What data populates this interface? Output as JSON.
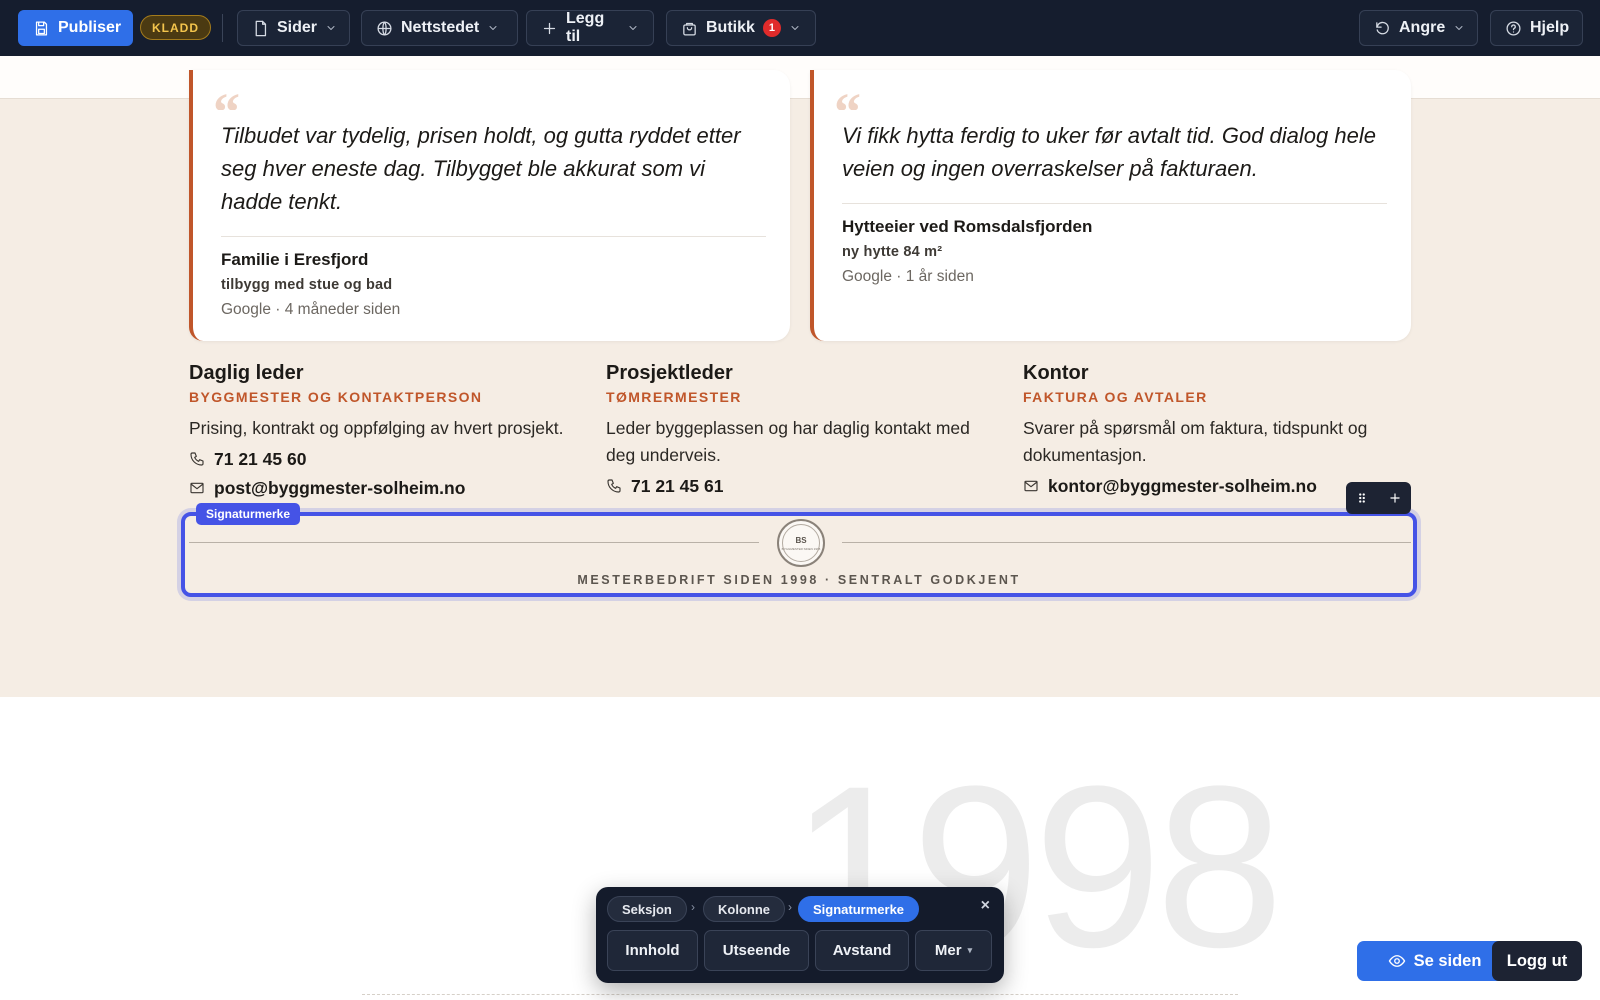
{
  "toolbar": {
    "publish_label": "Publiser",
    "draft_badge": "KLADD",
    "pages_label": "Sider",
    "site_label": "Nettstedet",
    "add_label": "Legg til",
    "shop_label": "Butikk",
    "shop_count": "1",
    "undo_label": "Angre",
    "help_label": "Hjelp"
  },
  "testimonials": [
    {
      "quote": "Tilbudet var tydelig, prisen holdt, og gutta ryddet etter seg hver eneste dag. Tilbygget ble akkurat som vi hadde tenkt.",
      "author": "Familie i Eresfjord",
      "project": "tilbygg med stue og bad",
      "source": "Google · 4 måneder siden"
    },
    {
      "quote": "Vi fikk hytta ferdig to uker før avtalt tid. God dialog hele veien og ingen overraskelser på fakturaen.",
      "author": "Hytteeier ved Romsdalsfjorden",
      "project": "ny hytte 84 m²",
      "source": "Google · 1 år siden"
    }
  ],
  "contacts": [
    {
      "role": "Daglig leder",
      "subtitle": "BYGGMESTER OG KONTAKTPERSON",
      "description": "Prising, kontrakt og oppfølging av hvert prosjekt.",
      "phone": "71 21 45 60",
      "email": "post@byggmester-solheim.no"
    },
    {
      "role": "Prosjektleder",
      "subtitle": "TØMRERMESTER",
      "description": "Leder byggeplassen og har daglig kontakt med deg underveis.",
      "phone": "71 21 45 61"
    },
    {
      "role": "Kontor",
      "subtitle": "FAKTURA OG AVTALER",
      "description": "Svarer på spørsmål om faktura, tidspunkt og dokumentasjon.",
      "email": "kontor@byggmester-solheim.no"
    }
  ],
  "signature": {
    "tag_label": "Signaturmerke",
    "seal_monogram": "BS",
    "seal_text": "BYGGMESTER SIDEN 1998",
    "text": "MESTERBEDRIFT SIDEN 1998 · SENTRALT GODKJENT"
  },
  "hero_year": "1998",
  "editor_panel": {
    "breadcrumb": [
      "Seksjon",
      "Kolonne",
      "Signaturmerke"
    ],
    "close_label": "×",
    "tabs": [
      "Innhold",
      "Utseende",
      "Avstand",
      "Mer"
    ],
    "more_caret": "▾"
  },
  "view_site_label": "Se siden",
  "logout_label": "Logg ut",
  "colors": {
    "accent": "#2f6fe8",
    "selection": "#4553e6",
    "brand_orange": "#c0562a",
    "page_bg": "#f5ede4"
  }
}
